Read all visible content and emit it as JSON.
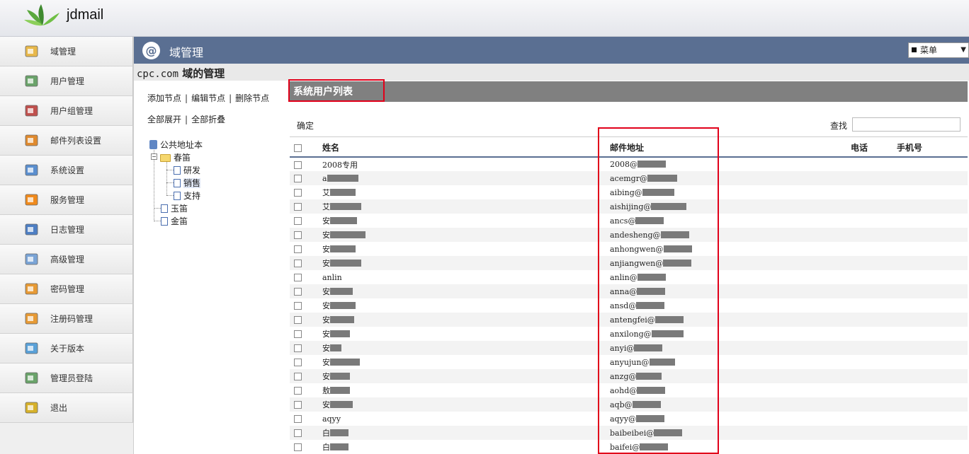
{
  "app": {
    "brand": "jdmail"
  },
  "sidebar": {
    "items": [
      {
        "label": "域管理",
        "icon": "domain-icon",
        "color": "#e8b84a"
      },
      {
        "label": "用户管理",
        "icon": "user-icon",
        "color": "#6aa36a"
      },
      {
        "label": "用户组管理",
        "icon": "user-group-icon",
        "color": "#c0504d"
      },
      {
        "label": "邮件列表设置",
        "icon": "mail-list-icon",
        "color": "#e08a2e"
      },
      {
        "label": "系统设置",
        "icon": "system-settings-icon",
        "color": "#5b8fcf"
      },
      {
        "label": "服务管理",
        "icon": "rss-service-icon",
        "color": "#f08a1c"
      },
      {
        "label": "日志管理",
        "icon": "log-icon",
        "color": "#4e7fc4"
      },
      {
        "label": "高级管理",
        "icon": "advanced-icon",
        "color": "#7aa4d6"
      },
      {
        "label": "密码管理",
        "icon": "password-icon",
        "color": "#e79a35"
      },
      {
        "label": "注册码管理",
        "icon": "license-icon",
        "color": "#e79a35"
      },
      {
        "label": "关于版本",
        "icon": "about-icon",
        "color": "#5aa1d8"
      },
      {
        "label": "管理员登陆",
        "icon": "admin-login-icon",
        "color": "#6aa36a"
      },
      {
        "label": "退出",
        "icon": "exit-icon",
        "color": "#d6b12a"
      }
    ]
  },
  "header": {
    "title": "域管理",
    "menu_label": "菜单"
  },
  "domain": {
    "name": "cpc.com",
    "suffix": " 域的管理"
  },
  "tree_panel": {
    "actions_row1": [
      "添加节点",
      "编辑节点",
      "删除节点"
    ],
    "actions_row2": [
      "全部展开",
      "全部折叠"
    ],
    "nodes": {
      "root": "公共地址本",
      "spring": "春笛",
      "rnd": "研发",
      "sales": "销售",
      "support": "支持",
      "jade": "玉笛",
      "gold": "金笛"
    }
  },
  "list": {
    "title": "系统用户列表",
    "confirm_label": "确定",
    "search_label": "查找",
    "search_value": "",
    "columns": [
      "姓名",
      "邮件地址",
      "电话",
      "手机号"
    ],
    "rows": [
      {
        "name": "2008专用",
        "name_mask": 0,
        "email": "2008@",
        "email_mask": 40
      },
      {
        "name": "a",
        "name_mask": 44,
        "email": "acemgr@",
        "email_mask": 42
      },
      {
        "name": "艾",
        "name_mask": 36,
        "email": "aibing@",
        "email_mask": 45
      },
      {
        "name": "艾",
        "name_mask": 44,
        "email": "aishijing@",
        "email_mask": 50
      },
      {
        "name": "安",
        "name_mask": 38,
        "email": "ancs@",
        "email_mask": 40
      },
      {
        "name": "安",
        "name_mask": 50,
        "email": "andesheng@",
        "email_mask": 40
      },
      {
        "name": "安",
        "name_mask": 36,
        "email": "anhongwen@",
        "email_mask": 40
      },
      {
        "name": "安",
        "name_mask": 44,
        "email": "anjiangwen@",
        "email_mask": 40
      },
      {
        "name": "anlin",
        "name_mask": 0,
        "email": "anlin@",
        "email_mask": 40
      },
      {
        "name": "安",
        "name_mask": 32,
        "email": "anna@",
        "email_mask": 40
      },
      {
        "name": "安",
        "name_mask": 36,
        "email": "ansd@",
        "email_mask": 40
      },
      {
        "name": "安",
        "name_mask": 34,
        "email": "antengfei@",
        "email_mask": 40
      },
      {
        "name": "安",
        "name_mask": 28,
        "email": "anxilong@",
        "email_mask": 45
      },
      {
        "name": "安",
        "name_mask": 16,
        "email": "anyi@",
        "email_mask": 40
      },
      {
        "name": "安",
        "name_mask": 42,
        "email": "anyujun@",
        "email_mask": 36
      },
      {
        "name": "安",
        "name_mask": 28,
        "email": "anzg@",
        "email_mask": 36
      },
      {
        "name": "敖",
        "name_mask": 28,
        "email": "aohd@",
        "email_mask": 40
      },
      {
        "name": "安",
        "name_mask": 32,
        "email": "aqb@",
        "email_mask": 40
      },
      {
        "name": "aqyy",
        "name_mask": 0,
        "email": "aqyy@",
        "email_mask": 40
      },
      {
        "name": "白",
        "name_mask": 26,
        "email": "baibeibei@",
        "email_mask": 40
      },
      {
        "name": "白",
        "name_mask": 26,
        "email": "baifei@",
        "email_mask": 40
      }
    ]
  },
  "colors": {
    "header_bg": "#5a6f92",
    "list_title_bg": "#808080",
    "highlight": "#e1001a"
  }
}
